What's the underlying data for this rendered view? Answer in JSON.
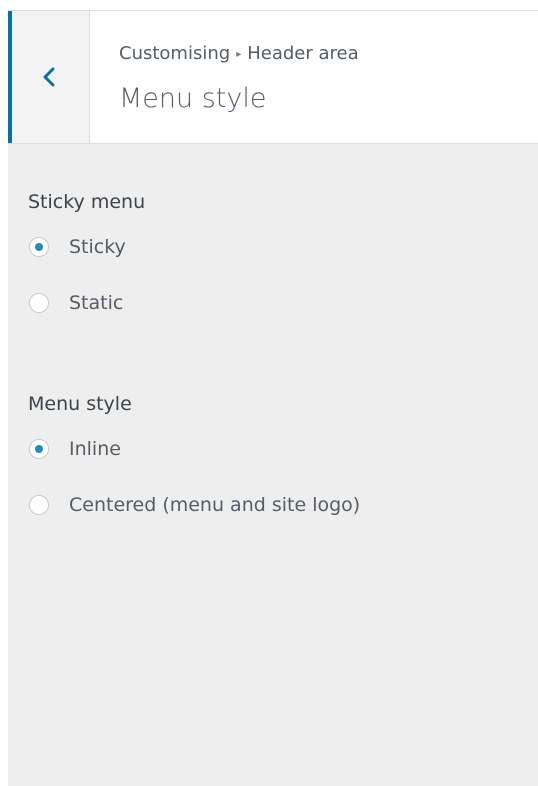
{
  "header": {
    "back_icon": "chevron-left-icon",
    "breadcrumb_parent": "Customising",
    "breadcrumb_separator": "▸",
    "breadcrumb_section": "Header area",
    "title": "Menu style"
  },
  "sections": [
    {
      "title": "Sticky menu",
      "options": [
        {
          "label": "Sticky",
          "checked": true
        },
        {
          "label": "Static",
          "checked": false
        }
      ]
    },
    {
      "title": "Menu style",
      "options": [
        {
          "label": "Inline",
          "checked": true
        },
        {
          "label": "Centered (menu and site logo)",
          "checked": false
        }
      ]
    }
  ],
  "colors": {
    "accent": "#0073aa",
    "radio_dot": "#1e8cbe",
    "panel_bg": "#eeeeee",
    "text": "#555d66"
  }
}
